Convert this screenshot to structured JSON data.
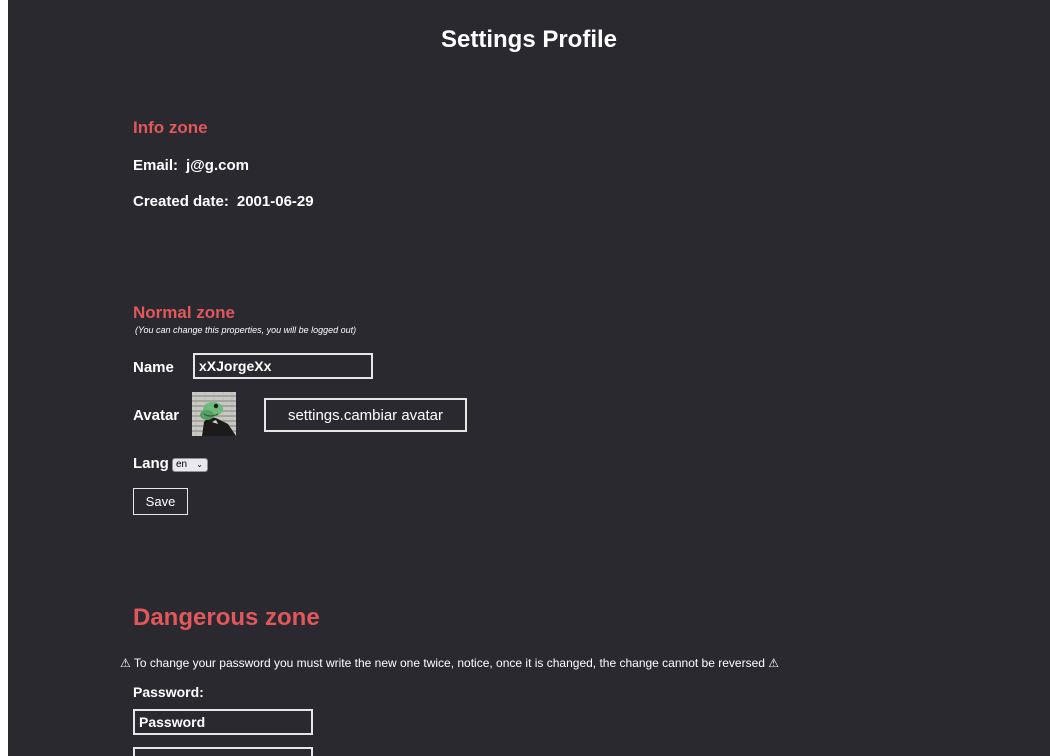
{
  "header": {
    "title": "Settings Profile"
  },
  "info_zone": {
    "title": "Info zone",
    "email_label": "Email:",
    "email_value": "j@g.com",
    "created_label": "Created date:",
    "created_value": "2001-06-29"
  },
  "normal_zone": {
    "title": "Normal zone",
    "note": "(You can change this properties, you will be logged out)",
    "name_label": "Name",
    "name_value": "xXJorgeXx",
    "avatar_label": "Avatar",
    "avatar_button": "settings.cambiar avatar",
    "lang_label": "Lang",
    "lang_selected": "en",
    "save_button": "Save"
  },
  "dangerous_zone": {
    "title": "Dangerous zone",
    "warning": "⚠ To change your password you must write the new one twice, notice, once it is changed, the change cannot be reversed ⚠",
    "password_label": "Password:",
    "password_placeholder": "Password",
    "password_confirm_placeholder": ""
  },
  "colors": {
    "background": "#2a2930",
    "accent": "#e0575c",
    "text": "#ffffff"
  }
}
